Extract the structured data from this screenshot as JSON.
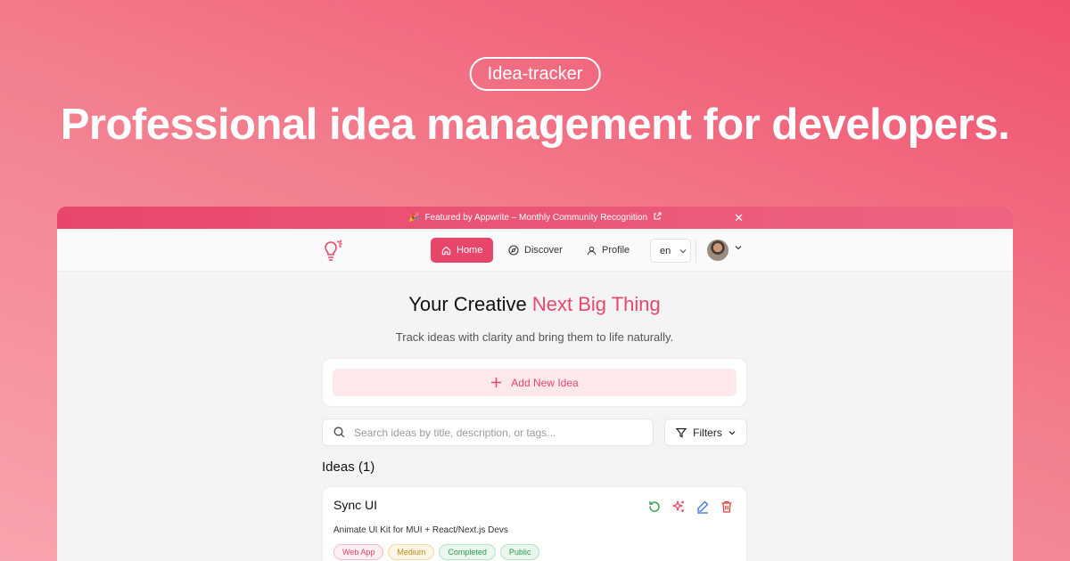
{
  "hero": {
    "badge": "Idea-tracker",
    "title": "Professional idea management for developers."
  },
  "banner": {
    "icon": "party-popper-icon",
    "text": "Featured by Appwrite – Monthly Community Recognition",
    "close": "✕"
  },
  "nav": {
    "items": [
      {
        "label": "Home",
        "icon": "home-icon",
        "active": true
      },
      {
        "label": "Discover",
        "icon": "compass-icon",
        "active": false
      },
      {
        "label": "Profile",
        "icon": "user-icon",
        "active": false
      }
    ],
    "language": "en"
  },
  "main": {
    "headline_prefix": "Your Creative",
    "headline_accent": "Next Big Thing",
    "subline": "Track ideas with clarity and bring them to life naturally.",
    "add_button": "Add New Idea",
    "search_placeholder": "Search ideas by title, description, or tags...",
    "filters_label": "Filters",
    "ideas_heading": "Ideas (1)"
  },
  "idea": {
    "title": "Sync UI",
    "description": "Animate UI Kit for MUI + React/Next.js Devs",
    "tags": [
      {
        "label": "Web App",
        "color": "#e8476b",
        "bg": "#fdeef1"
      },
      {
        "label": "Medium",
        "color": "#c08a1e",
        "bg": "#fdf6e4"
      },
      {
        "label": "Completed",
        "color": "#2e9a4b",
        "bg": "#eaf7ee"
      },
      {
        "label": "Public",
        "color": "#2e9a4b",
        "bg": "#eaf7ee"
      }
    ]
  },
  "colors": {
    "accent": "#e8476b",
    "background_top": "#f0506e",
    "background_bottom": "#f8a4ae"
  }
}
